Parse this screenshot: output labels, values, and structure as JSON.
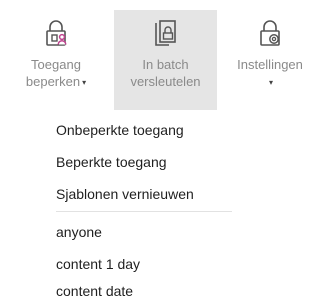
{
  "ribbon": {
    "buttons": [
      {
        "label_line1": "Toegang",
        "label_line2": "beperken",
        "icon": "lock-user-icon",
        "has_dropdown": true
      },
      {
        "label_line1": "In batch",
        "label_line2": "versleutelen",
        "icon": "batch-lock-icon",
        "has_dropdown": false
      },
      {
        "label_line1": "Instellingen",
        "label_line2": "",
        "icon": "lock-gear-icon",
        "has_dropdown": true
      }
    ],
    "caret": "▾"
  },
  "menu": {
    "items": [
      {
        "label": "Onbeperkte toegang"
      },
      {
        "label": "Beperkte toegang"
      },
      {
        "label": "Sjablonen vernieuwen"
      }
    ],
    "templates": [
      {
        "label": "anyone"
      },
      {
        "label": "content 1 day"
      },
      {
        "label": "content date"
      }
    ]
  },
  "colors": {
    "icon_stroke": "#555555",
    "accent": "#c0438f",
    "label_text": "#8a8a8a",
    "selected_bg": "#e5e5e5"
  }
}
